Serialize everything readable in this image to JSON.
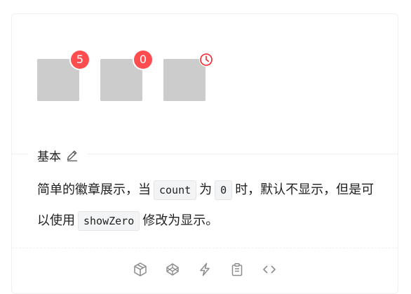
{
  "demo": {
    "badges": [
      {
        "kind": "count",
        "value": "5"
      },
      {
        "kind": "count",
        "value": "0"
      },
      {
        "kind": "icon",
        "icon": "clock-icon",
        "color": "#f5222d"
      }
    ],
    "badge_color": "#ff4d4f"
  },
  "meta": {
    "title": "基本",
    "edit_icon": "edit-icon",
    "desc_part1": "简单的徽章展示，当",
    "code1": "count",
    "desc_part2": "为",
    "code2": "0",
    "desc_part3": "时，默认不显示，但是可以使用",
    "code3": "showZero",
    "desc_part4": "修改为显示。"
  },
  "actions": {
    "icons": [
      "codesandbox-icon",
      "codepen-icon",
      "stackblitz-icon",
      "copy-icon",
      "expand-code-icon"
    ]
  }
}
